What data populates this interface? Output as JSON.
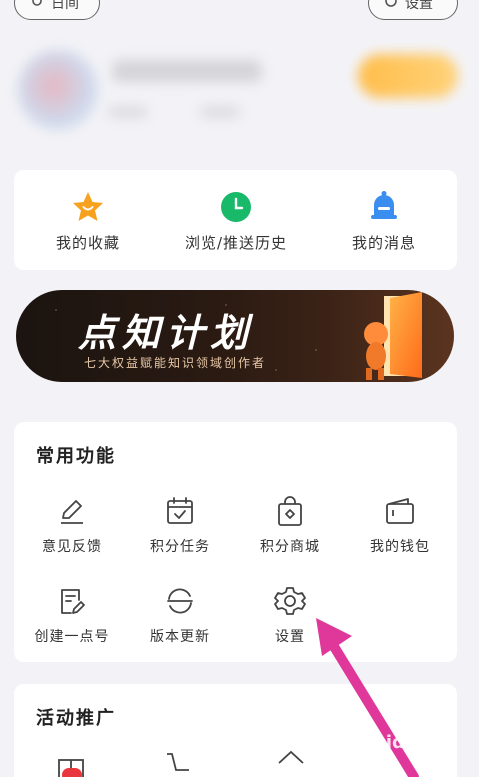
{
  "top": {
    "left_label": "日间",
    "right_label": "设置"
  },
  "quick_actions": [
    {
      "label": "我的收藏",
      "icon": "star-icon",
      "color": "#f6a21f"
    },
    {
      "label": "浏览/推送历史",
      "icon": "clock-icon",
      "color": "#19b96a"
    },
    {
      "label": "我的消息",
      "icon": "bell-icon",
      "color": "#3a8ef0"
    }
  ],
  "banner": {
    "title": "点知计划",
    "subtitle": "七大权益赋能知识领域创作者"
  },
  "functions": {
    "title": "常用功能",
    "items": [
      {
        "label": "意见反馈",
        "icon": "edit-icon"
      },
      {
        "label": "积分任务",
        "icon": "calendar-check-icon"
      },
      {
        "label": "积分商城",
        "icon": "shopping-bag-icon"
      },
      {
        "label": "我的钱包",
        "icon": "wallet-icon"
      },
      {
        "label": "创建一点号",
        "icon": "document-edit-icon"
      },
      {
        "label": "版本更新",
        "icon": "refresh-icon"
      },
      {
        "label": "设置",
        "icon": "gear-icon"
      }
    ]
  },
  "promo": {
    "title": "活动推广"
  },
  "watermark": "Baidu经验",
  "colors": {
    "arrow": "#e0389a",
    "accent_orange": "#f6a21f",
    "accent_green": "#19b96a",
    "accent_blue": "#3a8ef0"
  }
}
